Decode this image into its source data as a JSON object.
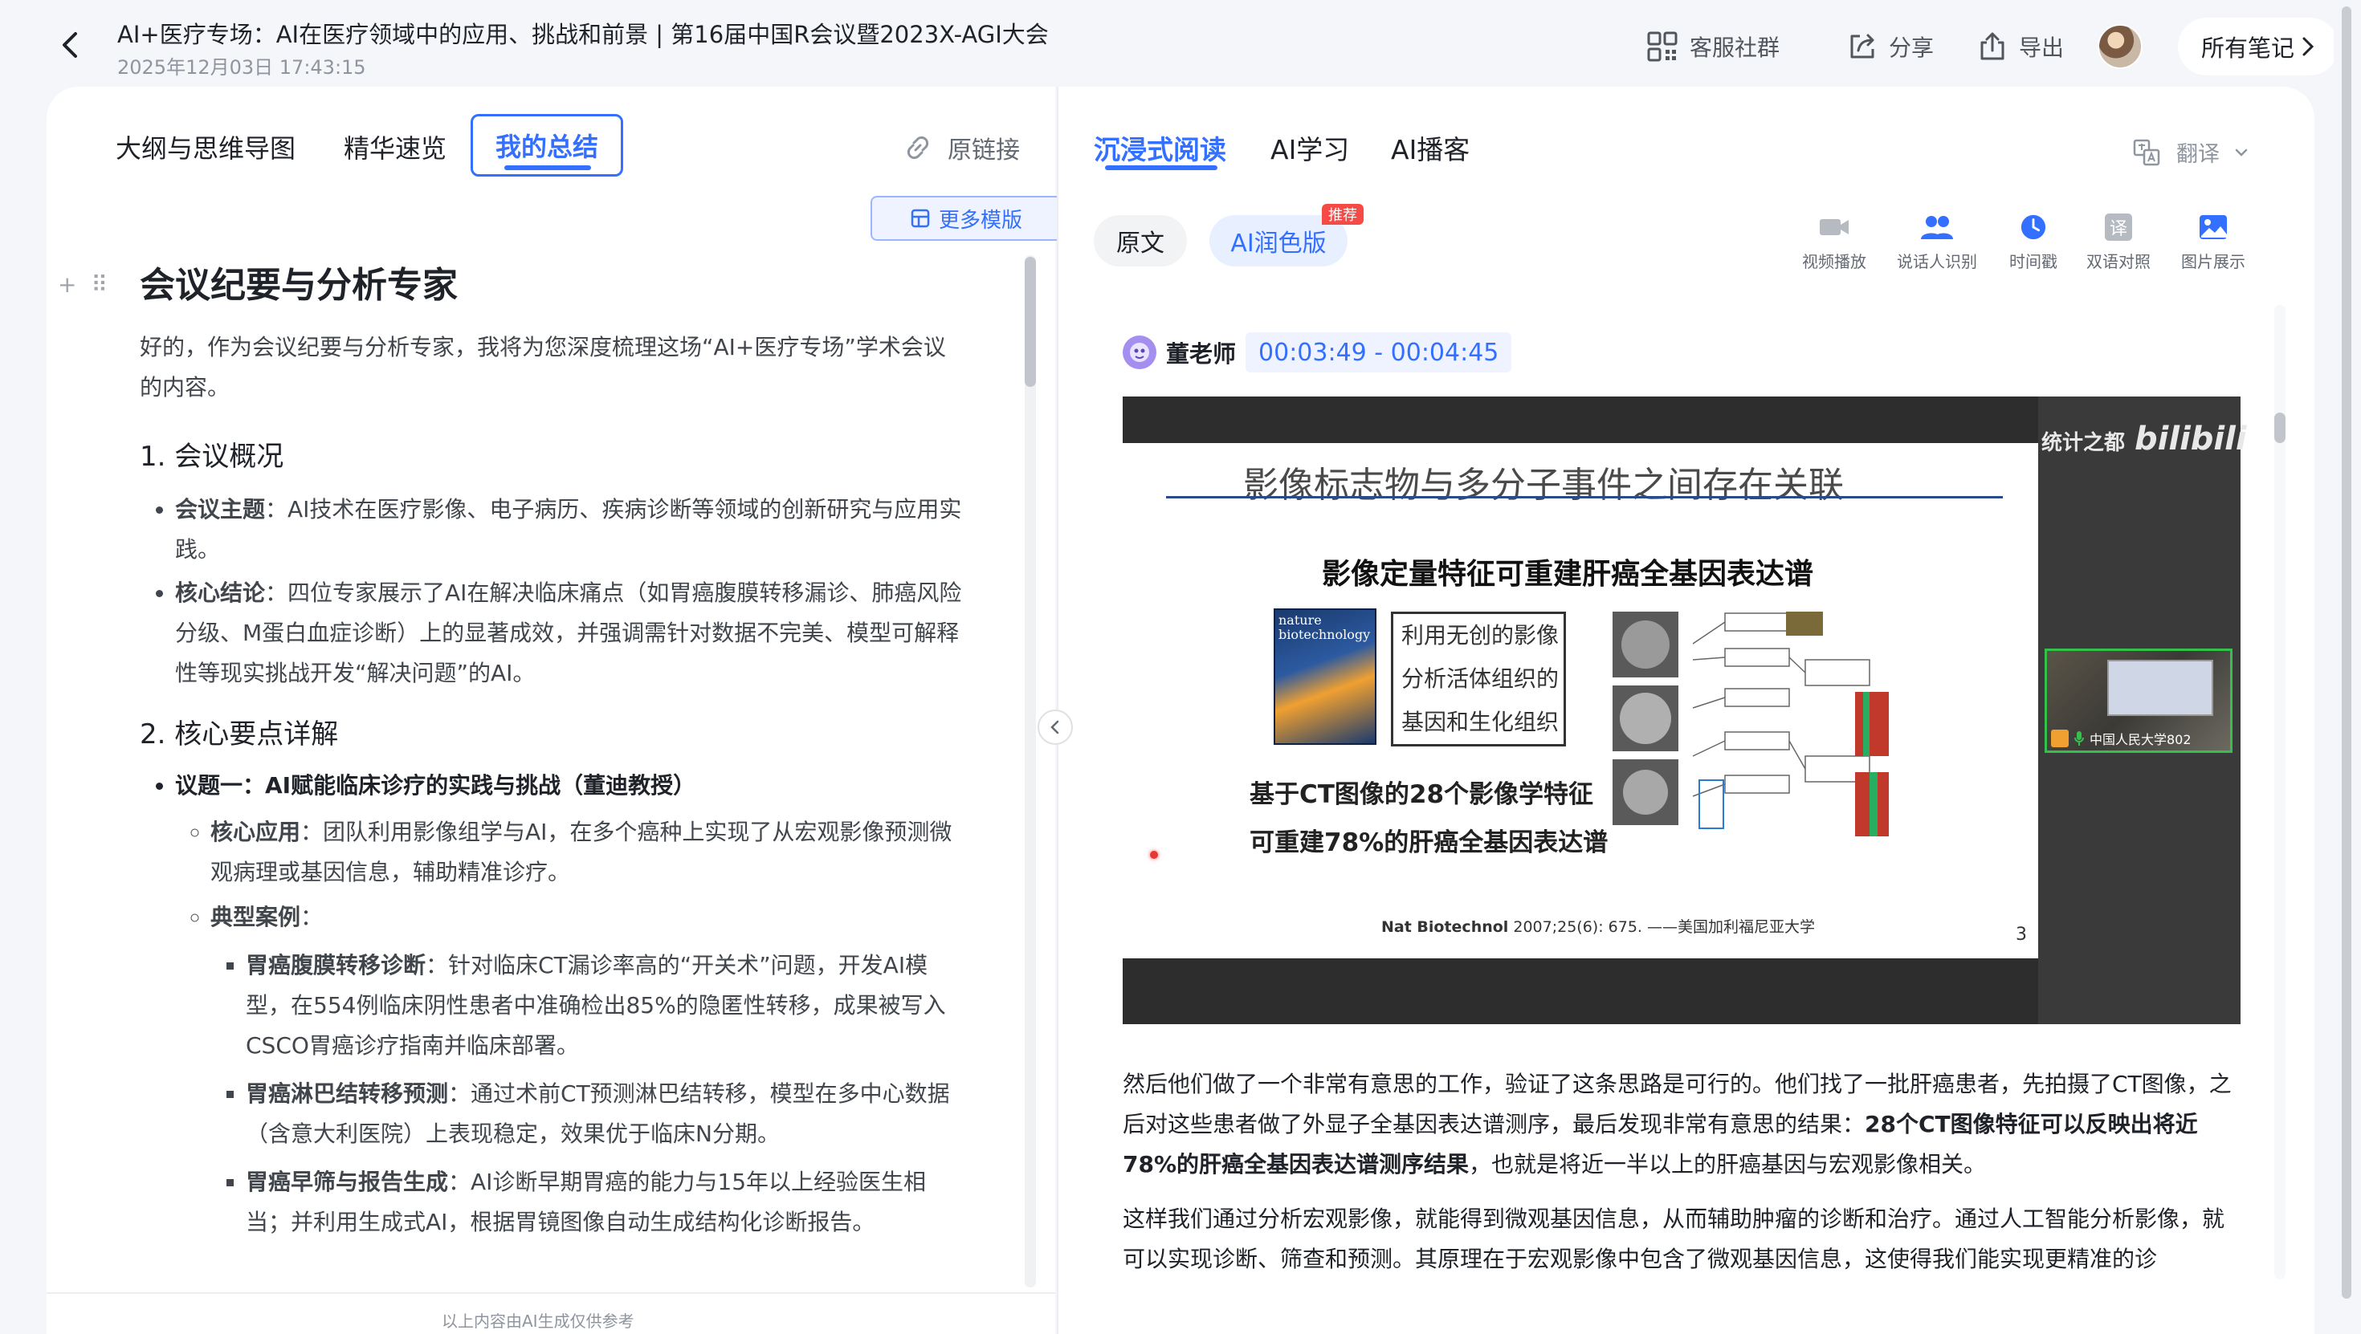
{
  "header": {
    "title": "AI+医疗专场：AI在医疗领域中的应用、挑战和前景 | 第16届中国R会议暨2023X-AGI大会",
    "datetime": "2025年12月03日 17:43:15",
    "community_label": "客服社群",
    "share_label": "分享",
    "export_label": "导出",
    "all_notes_label": "所有笔记"
  },
  "left": {
    "tabs": [
      "大纲与思维导图",
      "精华速览",
      "我的总结"
    ],
    "original_link_label": "原链接",
    "more_templates_label": "更多模版",
    "summary": {
      "title": "会议纪要与分析专家",
      "intro": "好的，作为会议纪要与分析专家，我将为您深度梳理这场“AI+医疗专场”学术会议的内容。",
      "section1_heading": "1. 会议概况",
      "s1_item1_label": "会议主题",
      "s1_item1_text": "：AI技术在医疗影像、电子病历、疾病诊断等领域的创新研究与应用实践。",
      "s1_item2_label": "核心结论",
      "s1_item2_text": "：四位专家展示了AI在解决临床痛点（如胃癌腹膜转移漏诊、肺癌风险分级、M蛋白血症诊断）上的显著成效，并强调需针对数据不完美、模型可解释性等现实挑战开发“解决问题”的AI。",
      "section2_heading": "2. 核心要点详解",
      "topic1": "议题一：AI赋能临床诊疗的实践与挑战（董迪教授）",
      "core_app_label": "核心应用",
      "core_app_text": "：团队利用影像组学与AI，在多个癌种上实现了从宏观影像预测微观病理或基因信息，辅助精准诊疗。",
      "cases_label": "典型案例",
      "cases_colon": "：",
      "case1_label": "胃癌腹膜转移诊断",
      "case1_text": "：针对临床CT漏诊率高的“开关术”问题，开发AI模型，在554例临床阴性患者中准确检出85%的隐匿性转移，成果被写入CSCO胃癌诊疗指南并临床部署。",
      "case2_label": "胃癌淋巴结转移预测",
      "case2_text": "：通过术前CT预测淋巴结转移，模型在多中心数据（含意大利医院）上表现稳定，效果优于临床N分期。",
      "case3_label": "胃癌早筛与报告生成",
      "case3_text": "：AI诊断早期胃癌的能力与15年以上经验医生相当；并利用生成式AI，根据胃镜图像自动生成结构化诊断报告。"
    },
    "disclaimer": "以上内容由AI生成仅供参考"
  },
  "right": {
    "tabs": [
      "沉浸式阅读",
      "AI学习",
      "AI播客"
    ],
    "translate_label": "翻译",
    "pill_original": "原文",
    "pill_polished": "AI润色版",
    "recommend_badge": "推荐",
    "tools": [
      "视频播放",
      "说话人识别",
      "时间戳",
      "双语对照",
      "图片展示"
    ],
    "bilingual_glyph": "译",
    "speaker_name": "董老师",
    "speaker_time": "00:03:49 - 00:04:45",
    "slide": {
      "title": "影像标志物与多分子事件之间存在关联",
      "subtitle": "影像定量特征可重建肝癌全基因表达谱",
      "journal_name": "nature biotechnology",
      "note_lines": [
        "利用无创的影像",
        "分析活体组织的",
        "基因和生化组织"
      ],
      "claim_line1": "基于CT图像的28个影像学特征",
      "claim_line2": "可重建78%的肝癌全基因表达谱",
      "citation_bold": "Nat Biotechnol",
      "citation_rest": " 2007;25(6): 675. ——美国加利福尼亚大学",
      "page_number": "3",
      "watermark_cn": "统计之都",
      "watermark_logo": "bilibili",
      "pip_label": "中国人民大学802"
    },
    "transcript_p1_a": "然后他们做了一个非常有意思的工作，验证了这条思路是可行的。他们找了一批肝癌患者，先拍摄了CT图像，之后对这些患者做了外显子全基因表达谱测序，最后发现非常有意思的结果：",
    "transcript_p1_bold": "28个CT图像特征可以反映出将近78%的肝癌全基因表达谱测序结果",
    "transcript_p1_b": "，也就是将近一半以上的肝癌基因与宏观影像相关。",
    "transcript_p2": "这样我们通过分析宏观影像，就能得到微观基因信息，从而辅助肿瘤的诊断和治疗。通过人工智能分析影像，就可以实现诊断、筛查和预测。其原理在于宏观影像中包含了微观基因信息，这使得我们能实现更精准的诊"
  },
  "colors": {
    "accent": "#3370ff",
    "badge": "#f54a45",
    "text": "#1f2329"
  }
}
